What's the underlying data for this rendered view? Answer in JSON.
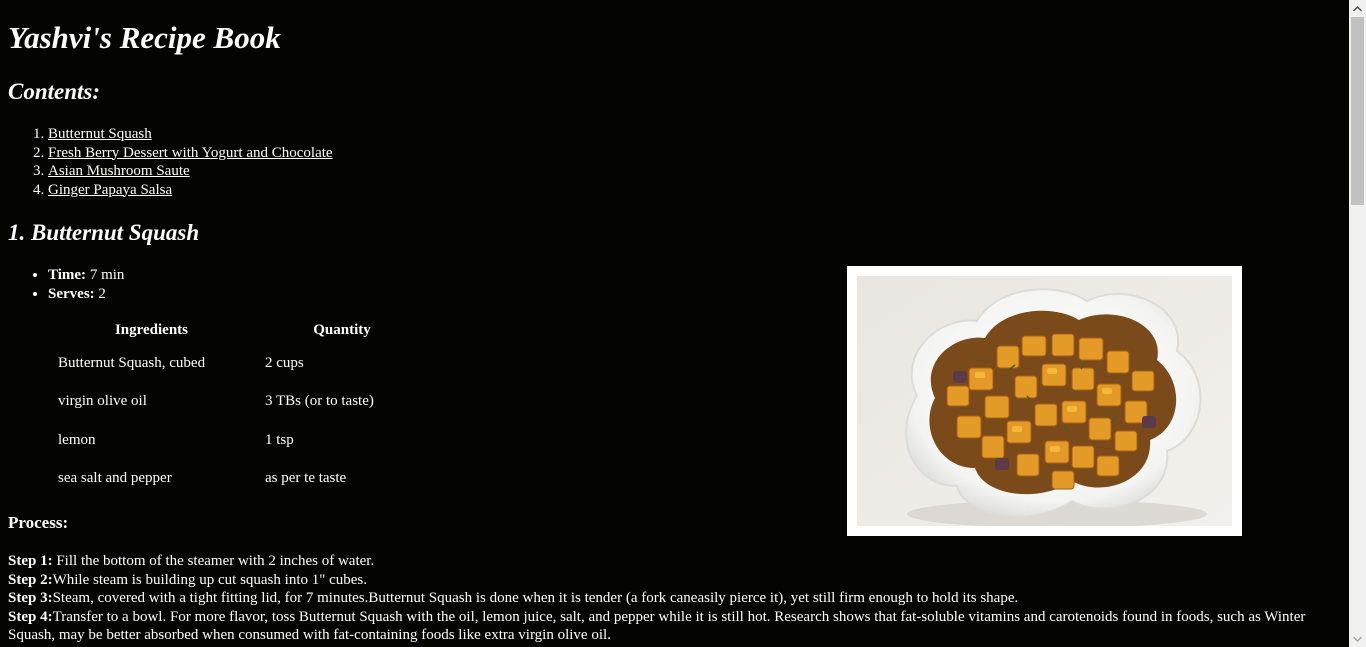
{
  "page": {
    "title": "Yashvi's Recipe Book",
    "contents_heading": "Contents:",
    "contents": [
      {
        "label": "Butternut Squash"
      },
      {
        "label": "Fresh Berry Dessert with Yogurt and Chocolate"
      },
      {
        "label": "Asian Mushroom Saute"
      },
      {
        "label": "Ginger Papaya Salsa"
      }
    ]
  },
  "recipe": {
    "heading": "1. Butternut Squash",
    "time_label": "Time:",
    "time_value": " 7 min",
    "serves_label": "Serves:",
    "serves_value": " 2",
    "table": {
      "headers": [
        "Ingredients",
        "Quantity"
      ],
      "rows": [
        [
          "Butternut Squash, cubed",
          "2 cups"
        ],
        [
          "virgin olive oil",
          "3 TBs (or to taste)"
        ],
        [
          "lemon",
          "1 tsp"
        ],
        [
          "sea salt and pepper",
          "as per te taste"
        ]
      ]
    },
    "process_heading": "Process:",
    "steps": [
      {
        "label": "Step 1:",
        "text": " Fill the bottom of the steamer with 2 inches of water."
      },
      {
        "label": "Step 2:",
        "text": "While steam is building up cut squash into 1\" cubes."
      },
      {
        "label": "Step 3:",
        "text": "Steam, covered with a tight fitting lid, for 7 minutes.Butternut Squash is done when it is tender (a fork caneasily pierce it), yet still firm enough to hold its shape."
      },
      {
        "label": "Step 4:",
        "text": "Transfer to a bowl. For more flavor, toss Butternut Squash with the oil, lemon juice, salt, and pepper while it is still hot. Research shows that fat-soluble vitamins and carotenoids found in foods, such as Winter Squash, may be better absorbed when consumed with fat-containing foods like extra virgin olive oil."
      }
    ]
  },
  "icons": {
    "scroll_up": "chevron-up-icon",
    "scroll_down": "chevron-down-icon"
  },
  "colors": {
    "background": "#040400",
    "text": "#ffffff",
    "scrollbar_track": "#f1f1f1",
    "scrollbar_thumb": "#c1c1c1"
  }
}
